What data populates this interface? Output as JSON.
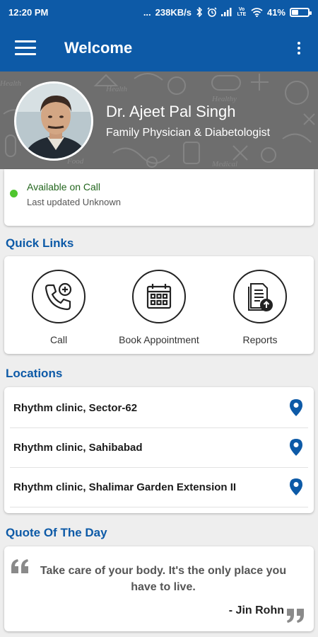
{
  "status_bar": {
    "time": "12:20 PM",
    "dots": "...",
    "net_speed": "238KB/s",
    "volte": "Vo LTE",
    "battery": "41%",
    "battery_level": 0.41
  },
  "app_bar": {
    "title": "Welcome",
    "menu_icon": "hamburger-menu-icon",
    "overflow_icon": "more-vert-icon"
  },
  "profile": {
    "name": "Dr. Ajeet Pal Singh",
    "specialty": "Family Physician & Diabetologist"
  },
  "availability": {
    "status": "Available on Call",
    "last_updated": "Last updated Unknown",
    "status_color": "#4fc62e"
  },
  "quick_links": {
    "title": "Quick Links",
    "items": [
      {
        "label": "Call",
        "icon": "phone-plus-icon"
      },
      {
        "label": "Book Appointment",
        "icon": "calendar-icon"
      },
      {
        "label": "Reports",
        "icon": "report-upload-icon"
      }
    ]
  },
  "locations": {
    "title": "Locations",
    "items": [
      {
        "name": "Rhythm clinic, Sector-62",
        "icon": "location-pin-icon"
      },
      {
        "name": "Rhythm clinic, Sahibabad",
        "icon": "location-pin-icon"
      },
      {
        "name": "Rhythm clinic, Shalimar Garden Extension II",
        "icon": "location-pin-icon"
      }
    ]
  },
  "quote": {
    "title": "Quote Of The Day",
    "text": "Take care of your body. It's the only place you have to live.",
    "author": "- Jin Rohn"
  },
  "colors": {
    "primary": "#0d5aa7",
    "available": "#23661e",
    "pin": "#0d5aa7"
  }
}
